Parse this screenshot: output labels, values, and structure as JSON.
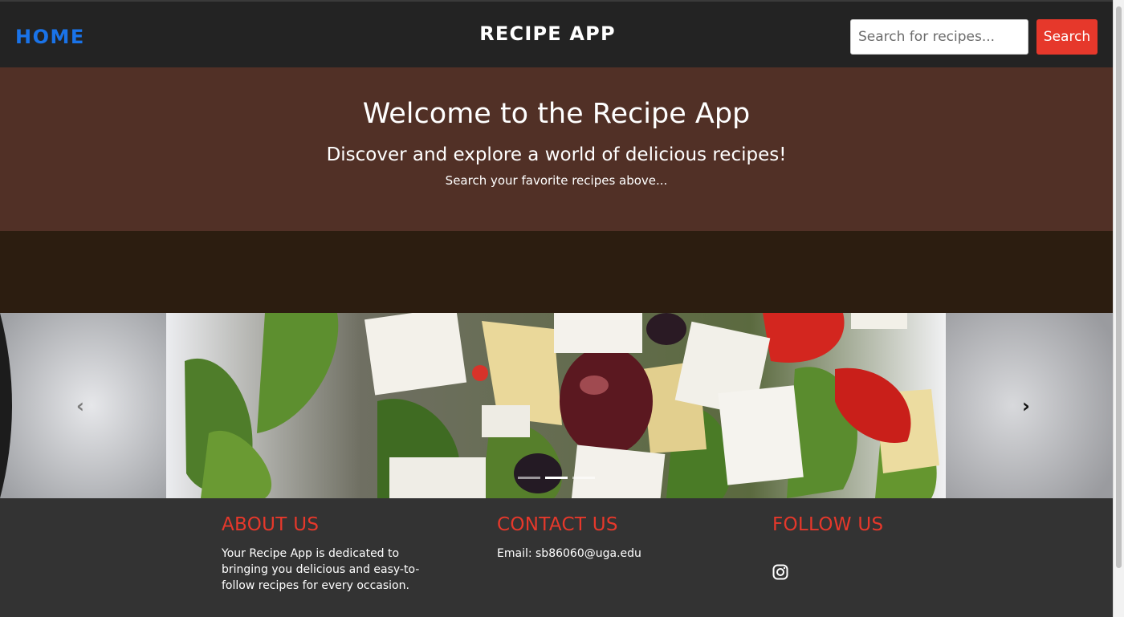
{
  "navbar": {
    "home_label": "HOME",
    "title": "RECIPE APP",
    "search_placeholder": "Search for recipes...",
    "search_value": "",
    "search_button_label": "Search"
  },
  "hero": {
    "title": "Welcome to the Recipe App",
    "subtitle": "Discover and explore a world of delicious recipes!",
    "hint": "Search your favorite recipes above..."
  },
  "carousel": {
    "prev_icon": "chevron-left-icon",
    "next_icon": "chevron-right-icon",
    "slide_count": 3,
    "active_slide": 2
  },
  "footer": {
    "about": {
      "heading": "ABOUT US",
      "text": "Your Recipe App is dedicated to bringing you delicious and easy-to-follow recipes for every occasion."
    },
    "contact": {
      "heading": "CONTACT US",
      "email_text": "Email: sb86060@uga.edu"
    },
    "follow": {
      "heading": "FOLLOW US",
      "icon": "instagram-icon"
    }
  },
  "colors": {
    "accent": "#e6382b",
    "home_link": "#1a73e8",
    "hero_bg": "#513026",
    "band_bg": "#2c1d10",
    "footer_bg": "#333333",
    "navbar_bg": "#232323"
  }
}
